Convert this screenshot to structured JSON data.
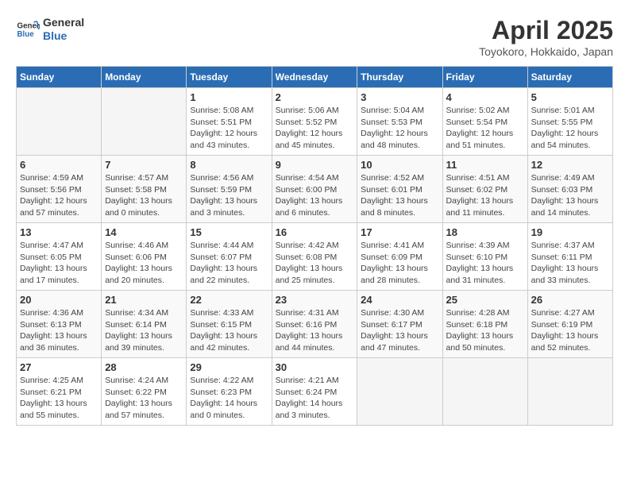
{
  "header": {
    "logo_line1": "General",
    "logo_line2": "Blue",
    "title": "April 2025",
    "subtitle": "Toyokoro, Hokkaido, Japan"
  },
  "days_of_week": [
    "Sunday",
    "Monday",
    "Tuesday",
    "Wednesday",
    "Thursday",
    "Friday",
    "Saturday"
  ],
  "weeks": [
    [
      {
        "day": "",
        "details": ""
      },
      {
        "day": "",
        "details": ""
      },
      {
        "day": "1",
        "details": "Sunrise: 5:08 AM\nSunset: 5:51 PM\nDaylight: 12 hours and 43 minutes."
      },
      {
        "day": "2",
        "details": "Sunrise: 5:06 AM\nSunset: 5:52 PM\nDaylight: 12 hours and 45 minutes."
      },
      {
        "day": "3",
        "details": "Sunrise: 5:04 AM\nSunset: 5:53 PM\nDaylight: 12 hours and 48 minutes."
      },
      {
        "day": "4",
        "details": "Sunrise: 5:02 AM\nSunset: 5:54 PM\nDaylight: 12 hours and 51 minutes."
      },
      {
        "day": "5",
        "details": "Sunrise: 5:01 AM\nSunset: 5:55 PM\nDaylight: 12 hours and 54 minutes."
      }
    ],
    [
      {
        "day": "6",
        "details": "Sunrise: 4:59 AM\nSunset: 5:56 PM\nDaylight: 12 hours and 57 minutes."
      },
      {
        "day": "7",
        "details": "Sunrise: 4:57 AM\nSunset: 5:58 PM\nDaylight: 13 hours and 0 minutes."
      },
      {
        "day": "8",
        "details": "Sunrise: 4:56 AM\nSunset: 5:59 PM\nDaylight: 13 hours and 3 minutes."
      },
      {
        "day": "9",
        "details": "Sunrise: 4:54 AM\nSunset: 6:00 PM\nDaylight: 13 hours and 6 minutes."
      },
      {
        "day": "10",
        "details": "Sunrise: 4:52 AM\nSunset: 6:01 PM\nDaylight: 13 hours and 8 minutes."
      },
      {
        "day": "11",
        "details": "Sunrise: 4:51 AM\nSunset: 6:02 PM\nDaylight: 13 hours and 11 minutes."
      },
      {
        "day": "12",
        "details": "Sunrise: 4:49 AM\nSunset: 6:03 PM\nDaylight: 13 hours and 14 minutes."
      }
    ],
    [
      {
        "day": "13",
        "details": "Sunrise: 4:47 AM\nSunset: 6:05 PM\nDaylight: 13 hours and 17 minutes."
      },
      {
        "day": "14",
        "details": "Sunrise: 4:46 AM\nSunset: 6:06 PM\nDaylight: 13 hours and 20 minutes."
      },
      {
        "day": "15",
        "details": "Sunrise: 4:44 AM\nSunset: 6:07 PM\nDaylight: 13 hours and 22 minutes."
      },
      {
        "day": "16",
        "details": "Sunrise: 4:42 AM\nSunset: 6:08 PM\nDaylight: 13 hours and 25 minutes."
      },
      {
        "day": "17",
        "details": "Sunrise: 4:41 AM\nSunset: 6:09 PM\nDaylight: 13 hours and 28 minutes."
      },
      {
        "day": "18",
        "details": "Sunrise: 4:39 AM\nSunset: 6:10 PM\nDaylight: 13 hours and 31 minutes."
      },
      {
        "day": "19",
        "details": "Sunrise: 4:37 AM\nSunset: 6:11 PM\nDaylight: 13 hours and 33 minutes."
      }
    ],
    [
      {
        "day": "20",
        "details": "Sunrise: 4:36 AM\nSunset: 6:13 PM\nDaylight: 13 hours and 36 minutes."
      },
      {
        "day": "21",
        "details": "Sunrise: 4:34 AM\nSunset: 6:14 PM\nDaylight: 13 hours and 39 minutes."
      },
      {
        "day": "22",
        "details": "Sunrise: 4:33 AM\nSunset: 6:15 PM\nDaylight: 13 hours and 42 minutes."
      },
      {
        "day": "23",
        "details": "Sunrise: 4:31 AM\nSunset: 6:16 PM\nDaylight: 13 hours and 44 minutes."
      },
      {
        "day": "24",
        "details": "Sunrise: 4:30 AM\nSunset: 6:17 PM\nDaylight: 13 hours and 47 minutes."
      },
      {
        "day": "25",
        "details": "Sunrise: 4:28 AM\nSunset: 6:18 PM\nDaylight: 13 hours and 50 minutes."
      },
      {
        "day": "26",
        "details": "Sunrise: 4:27 AM\nSunset: 6:19 PM\nDaylight: 13 hours and 52 minutes."
      }
    ],
    [
      {
        "day": "27",
        "details": "Sunrise: 4:25 AM\nSunset: 6:21 PM\nDaylight: 13 hours and 55 minutes."
      },
      {
        "day": "28",
        "details": "Sunrise: 4:24 AM\nSunset: 6:22 PM\nDaylight: 13 hours and 57 minutes."
      },
      {
        "day": "29",
        "details": "Sunrise: 4:22 AM\nSunset: 6:23 PM\nDaylight: 14 hours and 0 minutes."
      },
      {
        "day": "30",
        "details": "Sunrise: 4:21 AM\nSunset: 6:24 PM\nDaylight: 14 hours and 3 minutes."
      },
      {
        "day": "",
        "details": ""
      },
      {
        "day": "",
        "details": ""
      },
      {
        "day": "",
        "details": ""
      }
    ]
  ]
}
